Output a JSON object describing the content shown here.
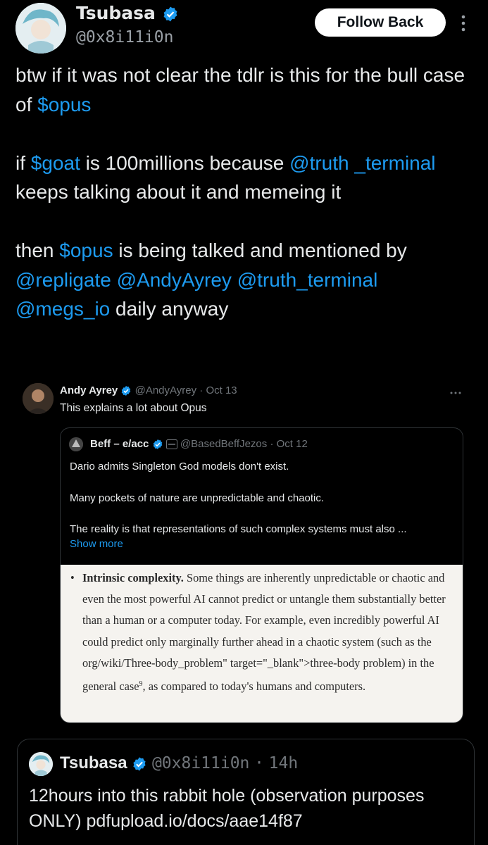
{
  "header": {
    "name": "Tsubasa",
    "handle": "@0x8i11i0n",
    "follow_label": "Follow Back"
  },
  "post": {
    "p1": {
      "t1": "btw if it was not clear the tdlr is this for the bull case of ",
      "l1": "$opus"
    },
    "p2": {
      "l1": "$goat",
      "t1": " is 100millions because ",
      "l2": "@truth _terminal",
      "t2": " keeps talking about it and memeing it",
      "t0": "if "
    },
    "p3": {
      "t0": "then ",
      "l1": "$opus",
      "t1": " is being talked and mentioned by ",
      "l2": "@repligate",
      "l3": "@AndyAyrey",
      "l4": "@truth_terminal",
      "l5": "@megs_io",
      "t2": " daily anyway"
    }
  },
  "quoted": {
    "name": "Andy Ayrey",
    "handle": "@AndyAyrey",
    "date": "Oct 13",
    "text": "This explains a lot about Opus",
    "inner": {
      "name": "Beff – e/acc",
      "handle": "@BasedBeffJezos",
      "date": "Oct 12",
      "p1": "Dario admits Singleton God models don't exist.",
      "p2": "Many pockets of nature are unpredictable and chaotic.",
      "p3": "The reality is that representations of such complex systems must also ...",
      "show_more": "Show more",
      "image": {
        "bold": "Intrinsic complexity.",
        "body": " Some things are inherently unpredictable or chaotic and even the most powerful AI cannot predict or untangle them substantially better than a human or a computer today. For example, even incredibly powerful AI could predict only marginally further ahead in a chaotic system (such as the org/wiki/Three-body_problem\" target=\"_blank\">three-body problem) in the general case",
        "sup": "9",
        "tail": ", as compared to today's humans and computers."
      }
    }
  },
  "bottom": {
    "name": "Tsubasa",
    "handle": "@0x8i11i0n",
    "time": "14h",
    "text_a": "12hours into this rabbit hole (observation purposes ONLY) ",
    "text_b": "pdfupload.io/docs/aae14f87"
  },
  "colors": {
    "accent": "#1d9bf0",
    "verified": "#1d9bf0",
    "background": "#000000"
  }
}
